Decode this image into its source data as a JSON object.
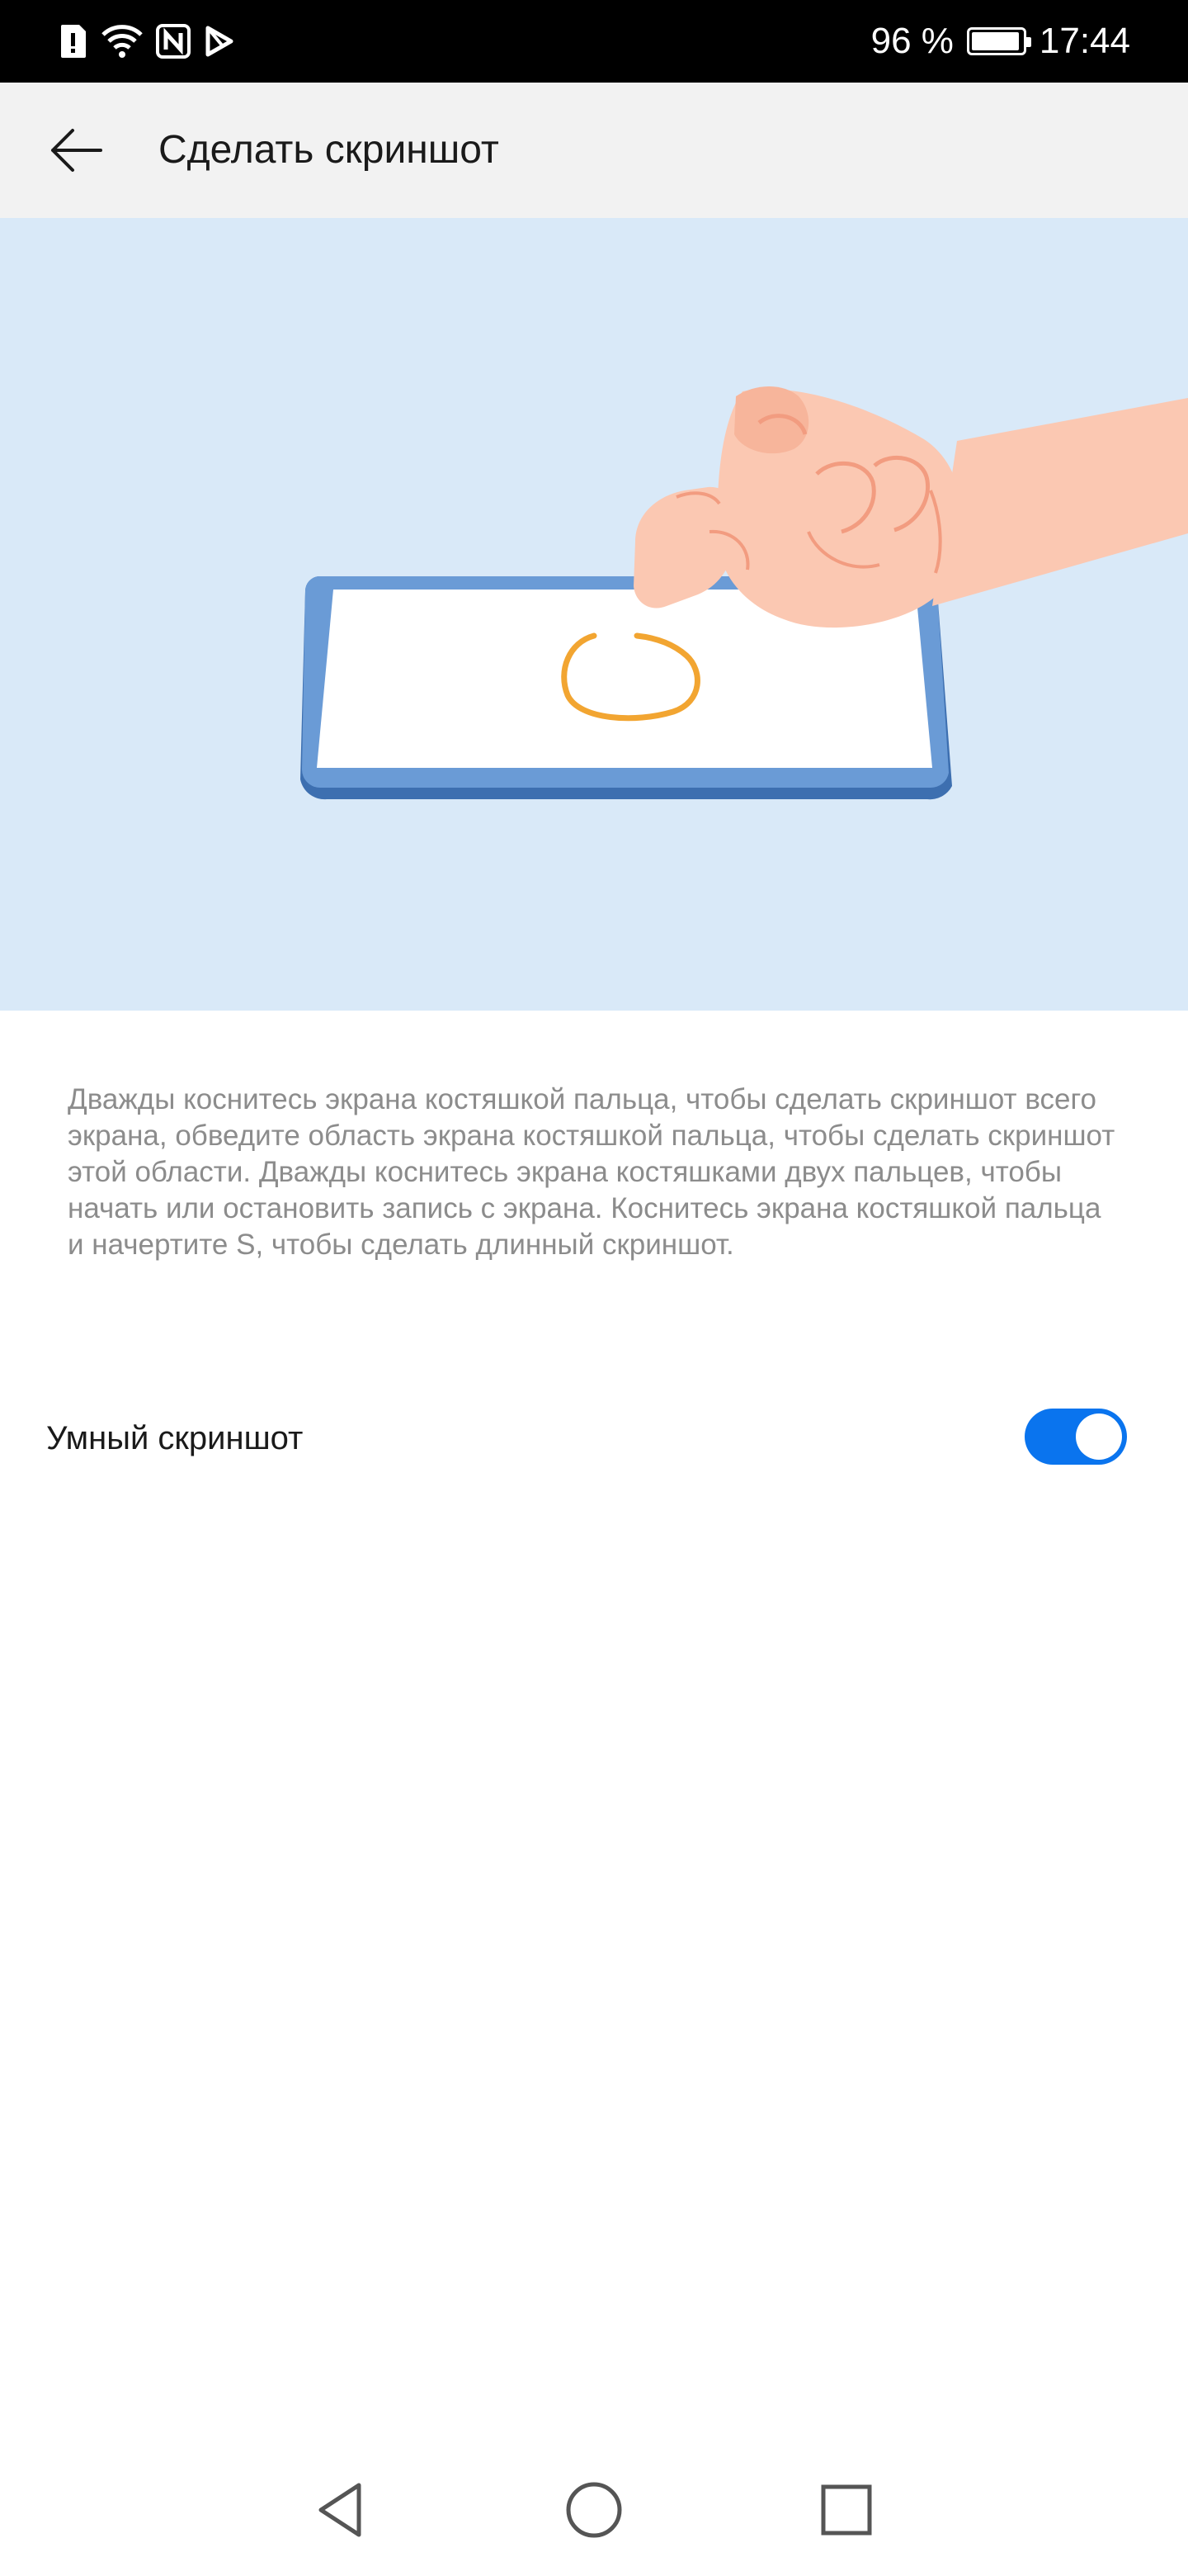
{
  "status_bar": {
    "battery_text": "96 %",
    "battery_level": 0.96,
    "time": "17:44",
    "icons": [
      "alert-sim-icon",
      "wifi-icon",
      "nfc-icon",
      "play-store-icon"
    ]
  },
  "app_bar": {
    "back_icon": "arrow-left-icon",
    "title": "Сделать скриншот"
  },
  "illustration": {
    "icon": "knuckle-gesture-illustration",
    "colors": {
      "background": "#d9e9f8",
      "phone_frame": "#5b8dc9",
      "screen": "#ffffff",
      "gesture_stroke": "#f2a531",
      "skin": "#fbc8b2"
    }
  },
  "description": "Дважды коснитесь экрана костяшкой пальца, чтобы сделать скриншот всего экрана, обведите область экрана костяшкой пальца, чтобы сделать скриншот этой области. Дважды коснитесь экрана костяшками двух пальцев, чтобы начать или остановить запись с экрана. Коснитесь экрана костяшкой пальца и начертите S, чтобы сделать длинный скриншот.",
  "smart_screenshot": {
    "label": "Умный скриншот",
    "enabled": true,
    "accent_color": "#0a74ee"
  },
  "nav_bar": {
    "icons": [
      "nav-back-icon",
      "nav-home-icon",
      "nav-recents-icon"
    ]
  }
}
